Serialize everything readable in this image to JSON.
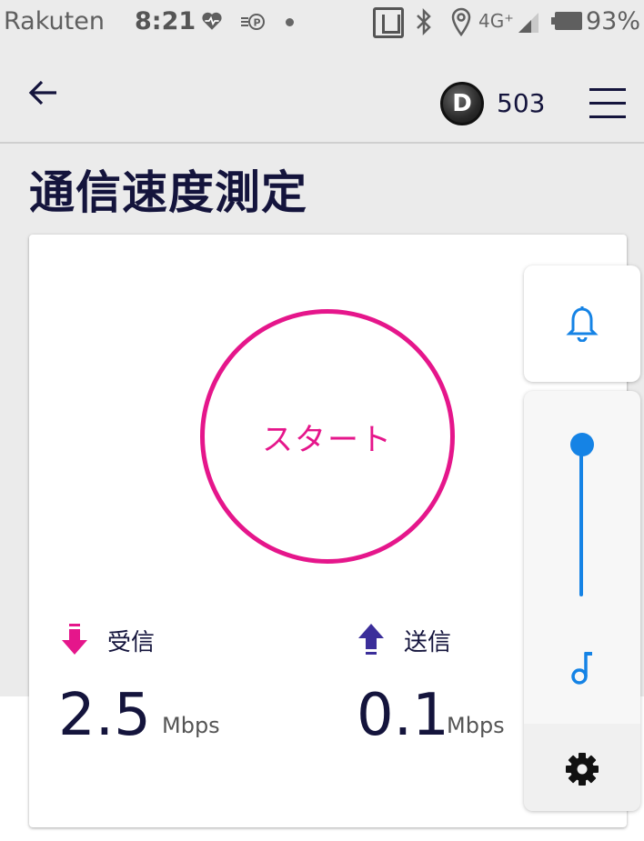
{
  "status_bar": {
    "carrier": "Rakuten",
    "time": "8:21",
    "network": "4G⁺",
    "battery": "93%"
  },
  "app_bar": {
    "points_badge": "D",
    "points_count": "503"
  },
  "page": {
    "title": "通信速度測定"
  },
  "speed_test": {
    "start_label": "スタート",
    "download": {
      "label": "受信",
      "value": "2.5",
      "unit": "Mbps"
    },
    "upload": {
      "label": "送信",
      "value": "0.1",
      "unit": "Mbps"
    }
  },
  "side_panel": {
    "volume_level": 1.0
  },
  "colors": {
    "accent": "#e5168b",
    "upload_arrow": "#3b2e9a",
    "panel_blue": "#1583e5",
    "text": "#14143c"
  }
}
